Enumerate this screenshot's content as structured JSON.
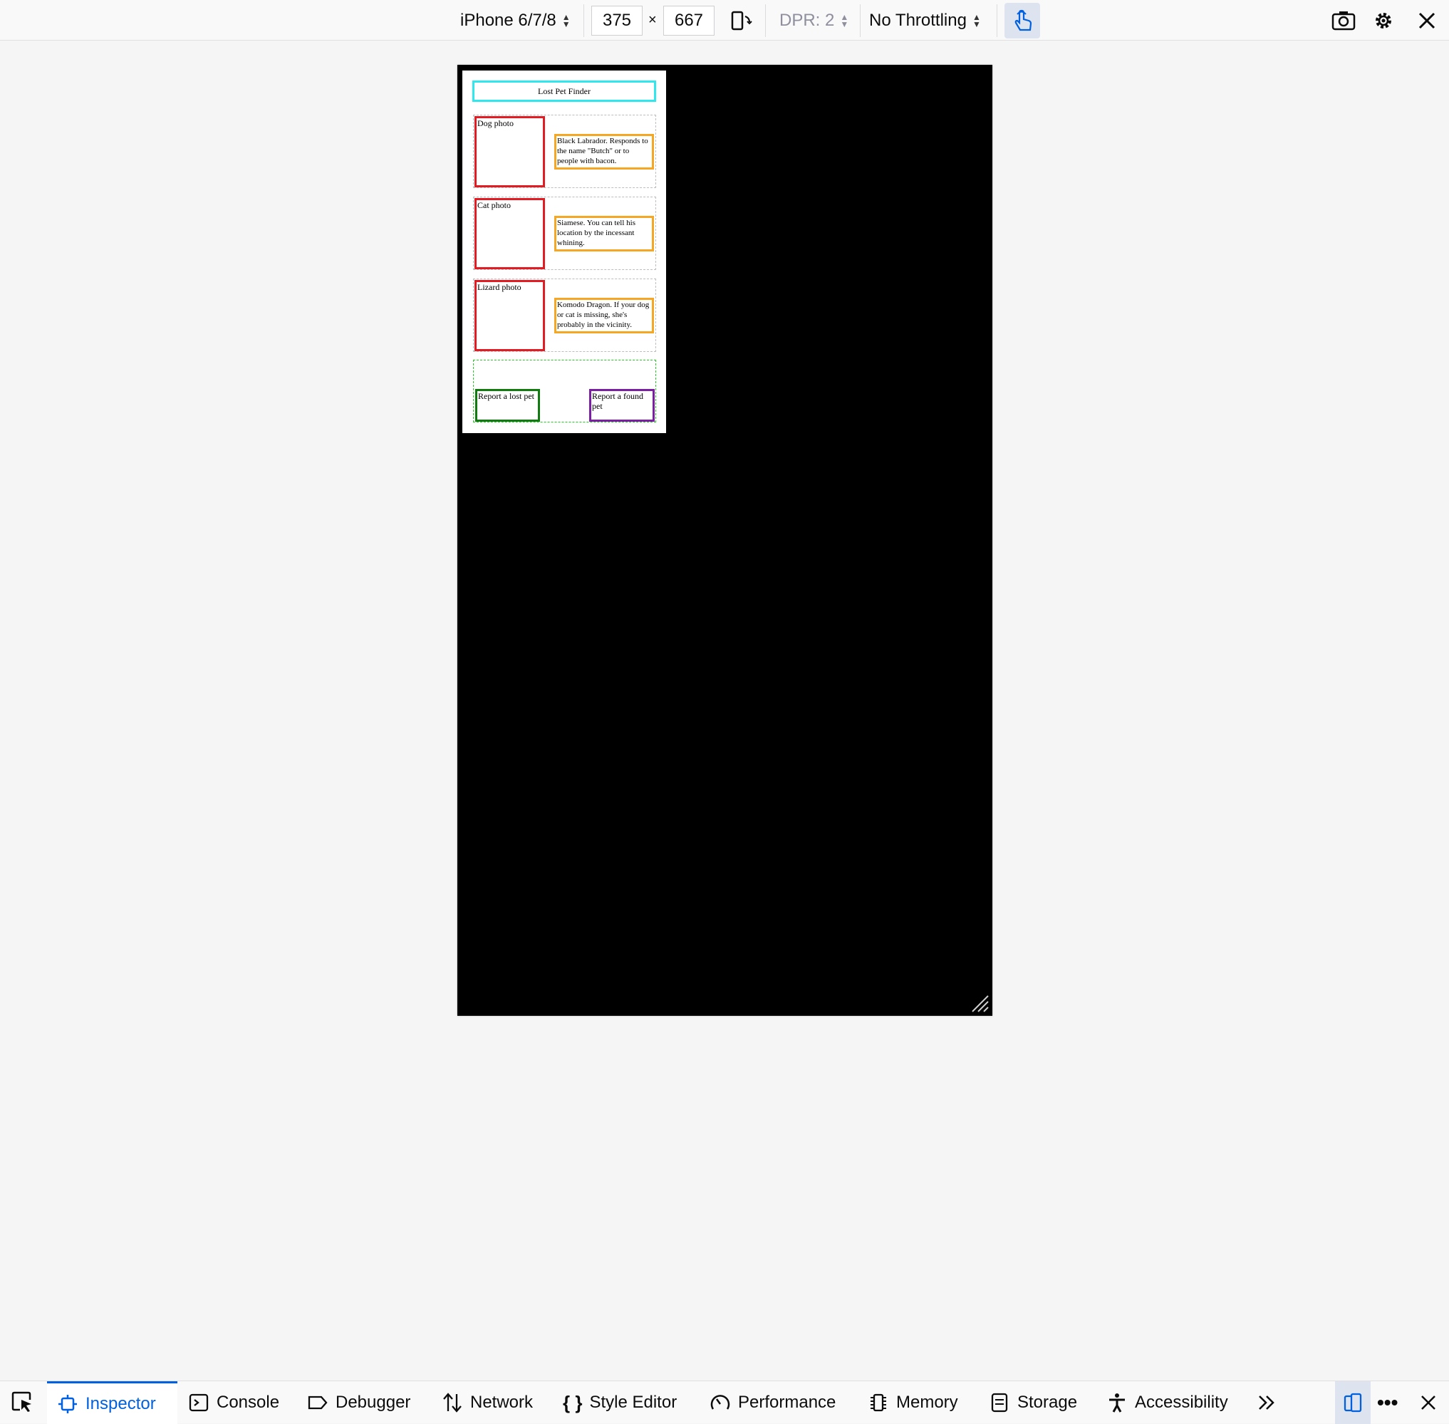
{
  "rdm_toolbar": {
    "device": "iPhone 6/7/8",
    "width": "375",
    "times": "×",
    "height": "667",
    "dpr": "DPR: 2",
    "throttling": "No Throttling"
  },
  "page": {
    "title": "Lost Pet Finder",
    "pets": [
      {
        "photo_label": "Dog photo",
        "description": "Black Labrador. Responds to the name \"Butch\" or to people with bacon."
      },
      {
        "photo_label": "Cat photo",
        "description": "Siamese. You can tell his location by the incessant whining."
      },
      {
        "photo_label": "Lizard photo",
        "description": "Komodo Dragon. If your dog or cat is missing, she's probably in the vicinity."
      }
    ],
    "report_lost": "Report a lost pet",
    "report_found": "Report a found pet"
  },
  "devtools": {
    "tabs": [
      "Inspector",
      "Console",
      "Debugger",
      "Network",
      "Style Editor",
      "Performance",
      "Memory",
      "Storage",
      "Accessibility"
    ],
    "active_tab": "Inspector",
    "accent": "#0060df"
  }
}
